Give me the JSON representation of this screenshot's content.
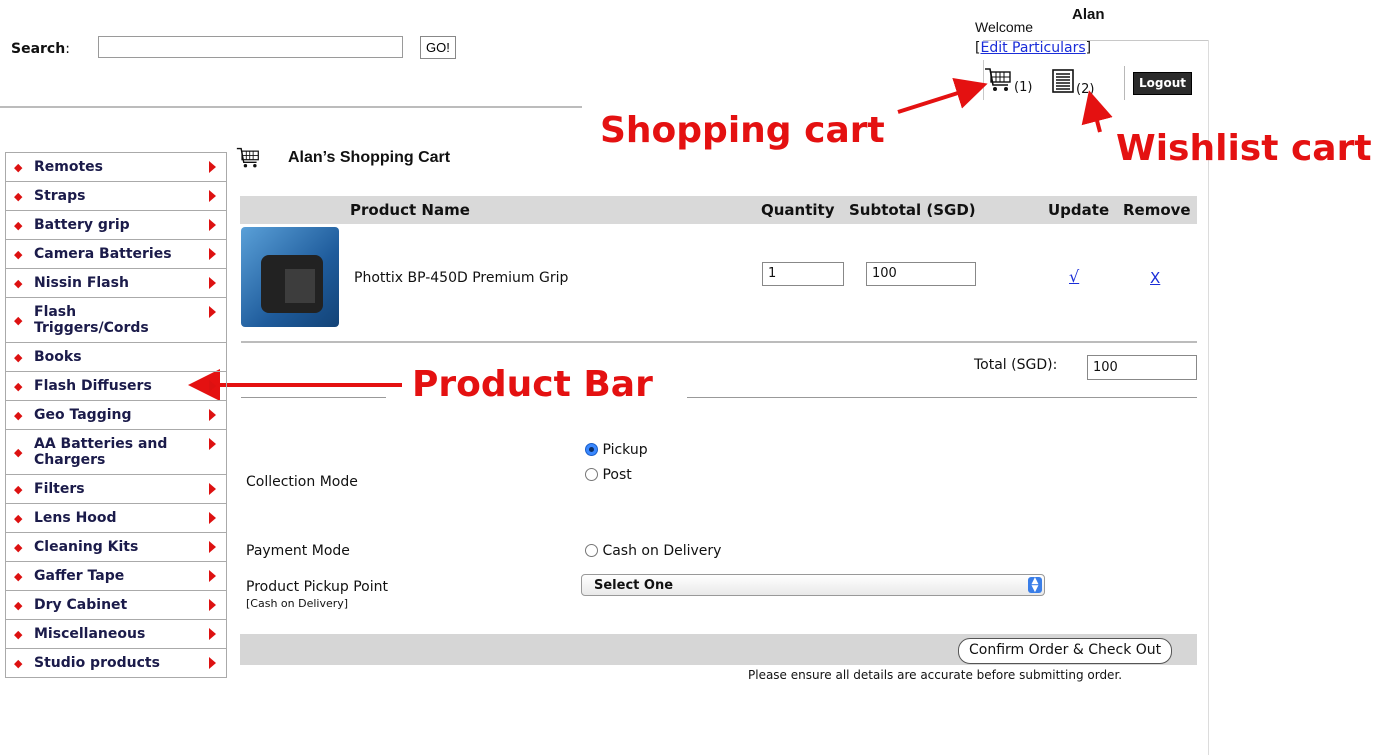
{
  "search": {
    "label": "Search",
    "colon": ":",
    "placeholder": "",
    "go_label": "GO!"
  },
  "user": {
    "welcome": "Welcome",
    "name": "Alan",
    "edit_particulars": "Edit Particulars",
    "bracket_open": "[",
    "bracket_close": "]",
    "cart_count": "(1)",
    "wishlist_count": "(2)",
    "logout": "Logout"
  },
  "annotations": {
    "shopping_cart": "Shopping cart",
    "wishlist_cart": "Wishlist cart",
    "product_bar": "Product Bar"
  },
  "sidebar": {
    "items": [
      {
        "label": "Remotes"
      },
      {
        "label": "Straps"
      },
      {
        "label": "Battery grip"
      },
      {
        "label": "Camera Batteries"
      },
      {
        "label": "Nissin Flash"
      },
      {
        "label": "Flash Triggers/Cords"
      },
      {
        "label": "Books"
      },
      {
        "label": "Flash Diffusers"
      },
      {
        "label": "Geo Tagging"
      },
      {
        "label": "AA Batteries and Chargers"
      },
      {
        "label": "Filters"
      },
      {
        "label": "Lens Hood"
      },
      {
        "label": "Cleaning Kits"
      },
      {
        "label": "Gaffer Tape"
      },
      {
        "label": "Dry Cabinet"
      },
      {
        "label": "Miscellaneous"
      },
      {
        "label": "Studio products"
      }
    ]
  },
  "cart": {
    "title": "Alan’s Shopping Cart",
    "columns": {
      "product_name": "Product Name",
      "quantity": "Quantity",
      "subtotal": "Subtotal (SGD)",
      "update": "Update",
      "remove": "Remove"
    },
    "items": [
      {
        "name": "Phottix BP-450D Premium Grip",
        "quantity": "1",
        "subtotal": "100",
        "update_icon": "√",
        "remove_icon": "X"
      }
    ],
    "total_label": "Total (SGD):",
    "total_value": "100"
  },
  "checkout": {
    "collection_label": "Collection Mode",
    "collection_options": [
      "Pickup",
      "Post"
    ],
    "collection_selected": "Pickup",
    "payment_label": "Payment Mode",
    "payment_option": "Cash on Delivery",
    "pickup_label": "Product Pickup Point",
    "pickup_sub": "[Cash on Delivery]",
    "pickup_selected": "Select One",
    "confirm_label": "Confirm Order & Check Out",
    "ensure_text": "Please ensure all details are accurate before submitting order."
  },
  "colors": {
    "accent_red": "#e41111",
    "link_blue": "#1a2dd8",
    "header_gray": "#d9d9d9"
  }
}
